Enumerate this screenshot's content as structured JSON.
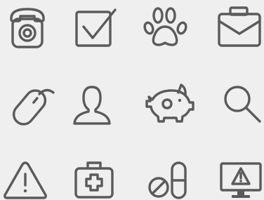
{
  "icon_sheet": {
    "background": "#efefef",
    "stroke_color": "#5a5a5a",
    "icons": [
      {
        "name": "telephone-icon"
      },
      {
        "name": "checkbox-icon"
      },
      {
        "name": "paw-print-icon"
      },
      {
        "name": "briefcase-icon"
      },
      {
        "name": "computer-mouse-icon"
      },
      {
        "name": "user-profile-icon"
      },
      {
        "name": "piggy-bank-icon"
      },
      {
        "name": "magnifier-search-icon"
      },
      {
        "name": "warning-triangle-icon"
      },
      {
        "name": "first-aid-kit-icon"
      },
      {
        "name": "pills-capsule-icon"
      },
      {
        "name": "monitor-alert-icon"
      }
    ]
  }
}
